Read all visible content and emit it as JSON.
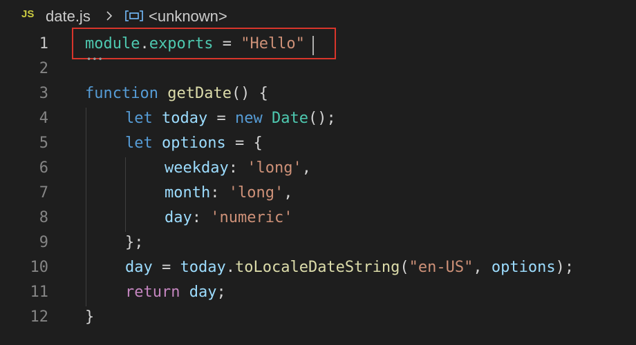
{
  "breadcrumb": {
    "file_badge": "JS",
    "file_name": "date.js",
    "symbol": "<unknown>"
  },
  "editor": {
    "active_line": 1,
    "lines": [
      {
        "number": "1"
      },
      {
        "number": "2"
      },
      {
        "number": "3"
      },
      {
        "number": "4"
      },
      {
        "number": "5"
      },
      {
        "number": "6"
      },
      {
        "number": "7"
      },
      {
        "number": "8"
      },
      {
        "number": "9"
      },
      {
        "number": "10"
      },
      {
        "number": "11"
      },
      {
        "number": "12"
      }
    ],
    "tokens": {
      "l1": [
        "module",
        ".",
        "exports",
        " = ",
        "\"Hello\""
      ],
      "l3": [
        "function",
        " ",
        "getDate",
        "() {"
      ],
      "l4": [
        "let",
        " ",
        "today",
        " = ",
        "new",
        " ",
        "Date",
        "();"
      ],
      "l5": [
        "let",
        " ",
        "options",
        " = {"
      ],
      "l6": [
        "weekday",
        ": ",
        "'long'",
        ","
      ],
      "l7": [
        "month",
        ": ",
        "'long'",
        ","
      ],
      "l8": [
        "day",
        ": ",
        "'numeric'"
      ],
      "l9": [
        "};"
      ],
      "l10": [
        "day",
        " = ",
        "today",
        ".",
        "toLocaleDateString",
        "(",
        "\"en-US\"",
        ", ",
        "options",
        ");"
      ],
      "l11": [
        "return",
        " ",
        "day",
        ";"
      ],
      "l12": [
        "}"
      ]
    }
  },
  "colors": {
    "background": "#1e1e1e",
    "keyword": "#569cd6",
    "control": "#c586c0",
    "variable": "#9cdcfe",
    "class": "#4ec9b0",
    "function": "#dcdcaa",
    "string": "#ce9178",
    "highlight_border": "#d9352b"
  },
  "icons": {
    "breadcrumb_separator": "chevron-right-icon",
    "symbol": "symbol-variable-icon"
  }
}
